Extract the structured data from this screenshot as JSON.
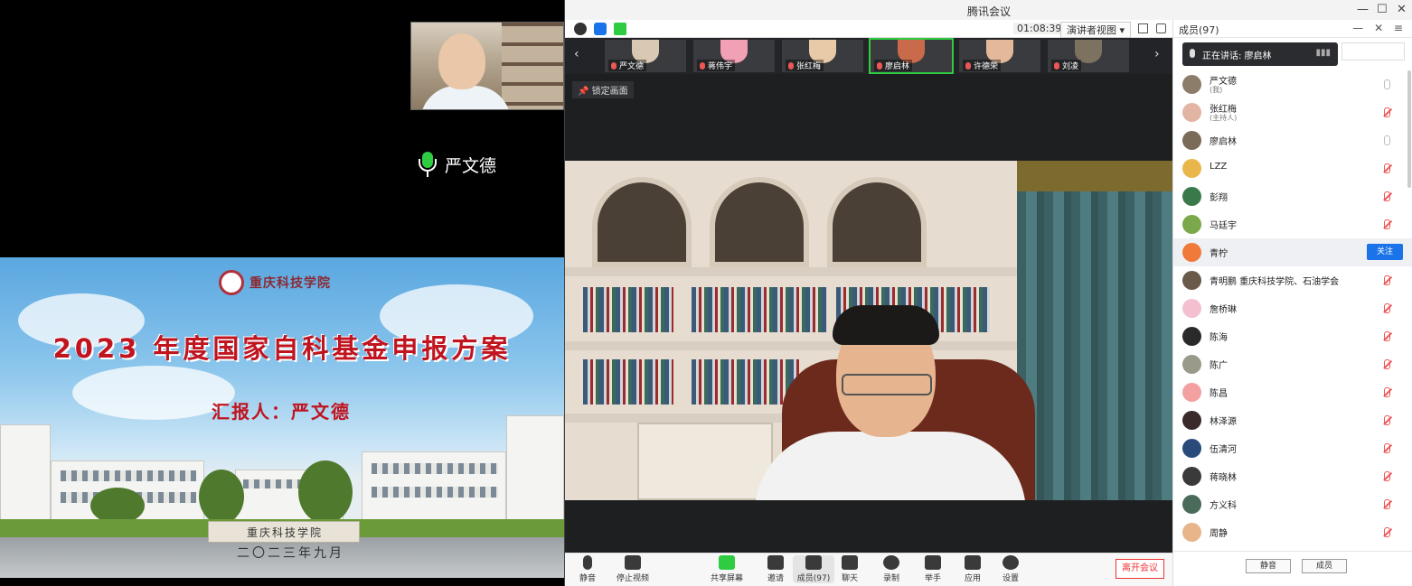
{
  "shared_screen": {
    "speaker_name": "严文德",
    "slide": {
      "logo_text": "重庆科技学院",
      "title": "2023 年度国家自科基金申报方案",
      "presenter": "汇报人：严文德",
      "stone_text": "重庆科技学院",
      "date": "二〇二三年九月"
    }
  },
  "window": {
    "title": "腾讯会议",
    "controls": [
      "—",
      "☐",
      "✕"
    ]
  },
  "top_toolbar": {
    "timer": "01:08:39",
    "view_label": "演讲者视图 ▾"
  },
  "video_strip": {
    "tiles": [
      {
        "name": "严文德",
        "color": "#d9c9b2",
        "active": false
      },
      {
        "name": "蒋伟宇",
        "color": "#f2a0b4",
        "active": false
      },
      {
        "name": "张红梅",
        "color": "#e8c9a8",
        "active": false
      },
      {
        "name": "廖启林",
        "color": "#c96a4a",
        "active": true
      },
      {
        "name": "许德荣",
        "color": "#e3b99a",
        "active": false
      },
      {
        "name": "刘凌",
        "color": "#7d7260",
        "active": false
      }
    ]
  },
  "lock_label": "锁定画面",
  "bottom_controls": {
    "items": [
      "静音",
      "停止视频",
      "共享屏幕",
      "邀请",
      "成员(97)",
      "聊天",
      "录制",
      "举手",
      "应用",
      "设置"
    ],
    "leave": "离开会议"
  },
  "panel": {
    "title": "成员(97)",
    "ops": "— ✕ ≡",
    "speaking": "正在讲话: 廖启林",
    "participants": [
      {
        "name": "严文德",
        "sub": "(我)",
        "muted": false,
        "color": "#8c7c6a"
      },
      {
        "name": "张红梅",
        "sub": "(主持人)",
        "muted": true,
        "color": "#e2b4a4"
      },
      {
        "name": "廖启林",
        "sub": "",
        "muted": false,
        "color": "#7a6a58"
      },
      {
        "name": "LZZ",
        "sub": "",
        "muted": true,
        "color": "#e8b64a"
      },
      {
        "name": "彭翔",
        "sub": "",
        "muted": true,
        "color": "#3a7a4a"
      },
      {
        "name": "马廷宇",
        "sub": "",
        "muted": true,
        "color": "#7aa84a"
      },
      {
        "name": "青柠",
        "sub": "",
        "muted": false,
        "color": "#f07a3a",
        "highlight": true,
        "action": "关注"
      },
      {
        "name": "青明鹏 重庆科技学院、石油学会",
        "sub": "",
        "muted": true,
        "color": "#6a5a4a"
      },
      {
        "name": "詹桥琳",
        "sub": "",
        "muted": true,
        "color": "#f4c0d0"
      },
      {
        "name": "陈海",
        "sub": "",
        "muted": true,
        "color": "#2a2a2a"
      },
      {
        "name": "陈广",
        "sub": "",
        "muted": true,
        "color": "#9a9a8a"
      },
      {
        "name": "陈昌",
        "sub": "",
        "muted": true,
        "color": "#f2a0a0"
      },
      {
        "name": "林泽源",
        "sub": "",
        "muted": true,
        "color": "#3a2a2a"
      },
      {
        "name": "伍清河",
        "sub": "",
        "muted": true,
        "color": "#2a4a7a"
      },
      {
        "name": "蒋晓林",
        "sub": "",
        "muted": true,
        "color": "#3a3a3a"
      },
      {
        "name": "方义科",
        "sub": "",
        "muted": true,
        "color": "#4a6a5a"
      },
      {
        "name": "周静",
        "sub": "",
        "muted": true,
        "color": "#e8b48a"
      }
    ],
    "footer": [
      "静音",
      "成员"
    ]
  }
}
